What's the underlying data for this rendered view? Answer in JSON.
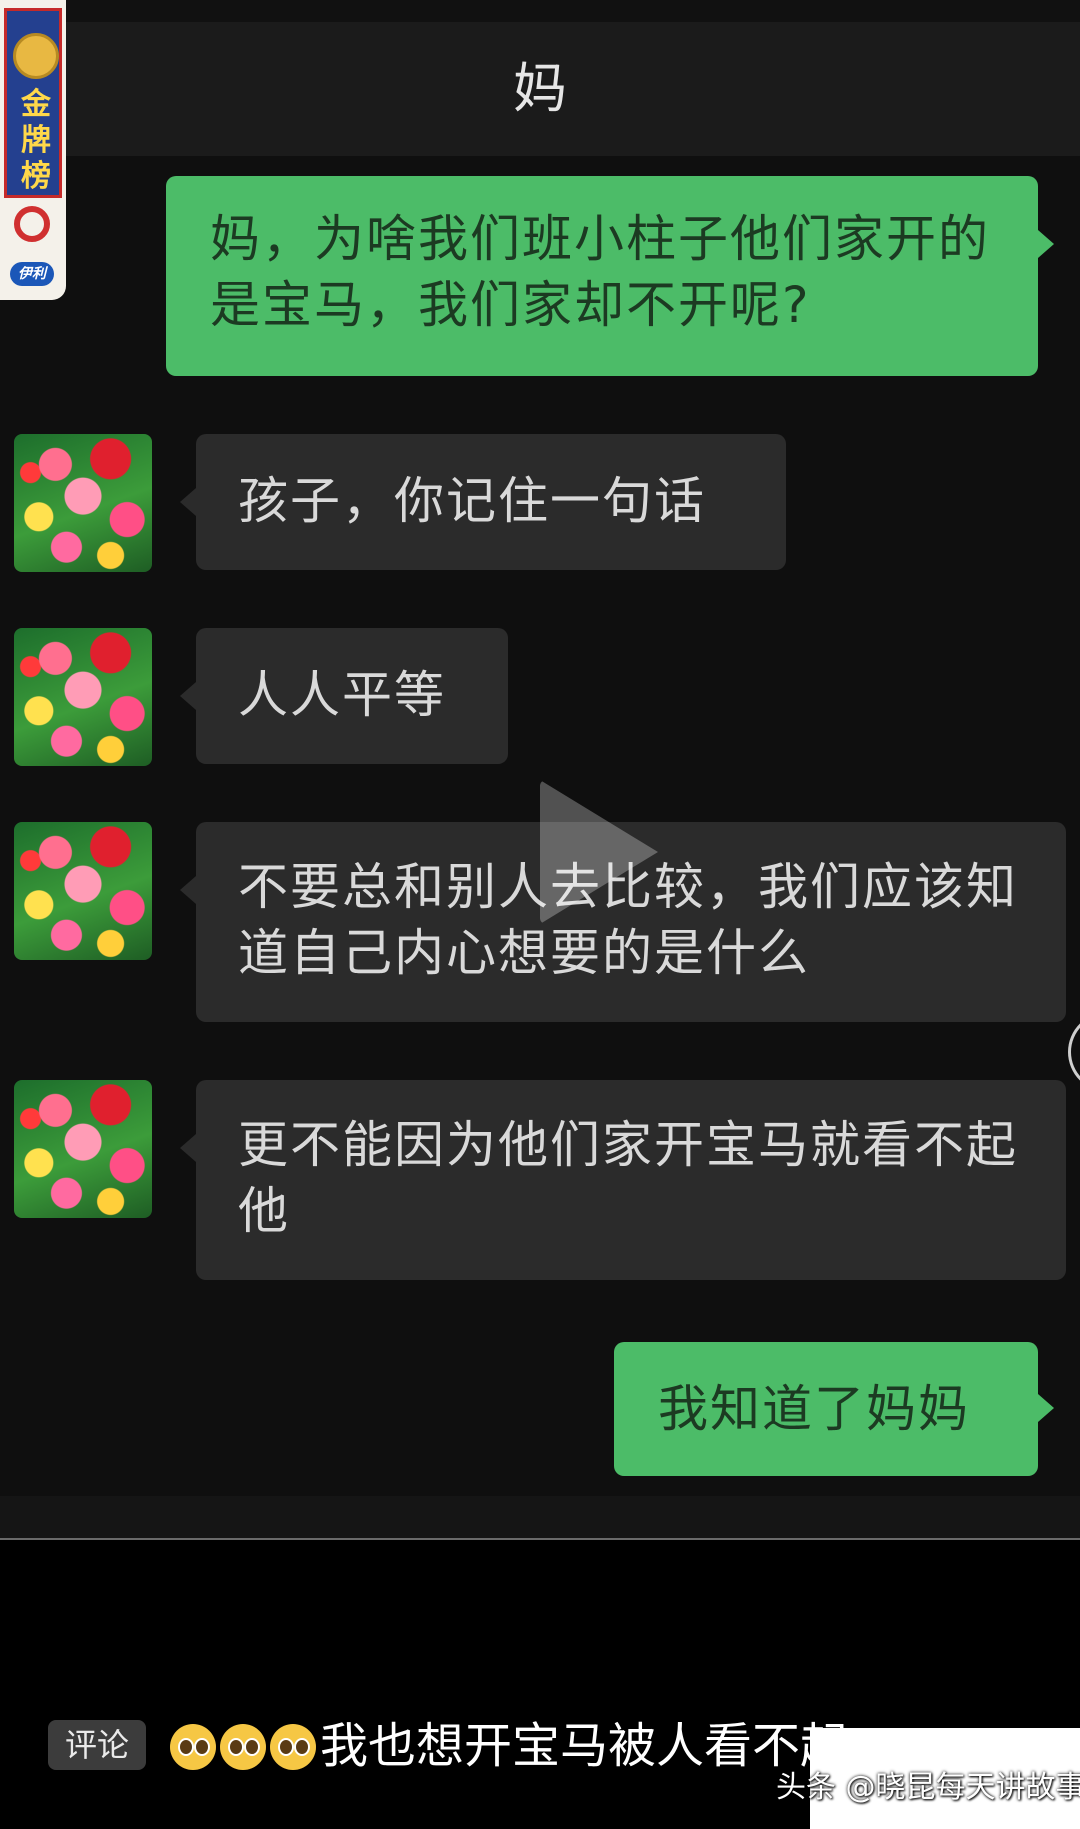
{
  "badge": {
    "medal_label": "金牌榜",
    "sponsor_logo": "伊利"
  },
  "chat": {
    "title": "妈",
    "messages": [
      {
        "side": "out",
        "text": "妈，为啥我们班小柱子他们家开的是宝马，我们家却不开呢?"
      },
      {
        "side": "in",
        "text": "孩子，你记住一句话"
      },
      {
        "side": "in",
        "text": "人人平等"
      },
      {
        "side": "in",
        "text": "不要总和别人去比较，我们应该知道自己内心想要的是什么"
      },
      {
        "side": "in",
        "text": "更不能因为他们家开宝马就看不起他"
      },
      {
        "side": "out",
        "text": "我知道了妈妈"
      }
    ]
  },
  "comment_bar": {
    "chip_label": "评论",
    "emoji_icon": "pleading-face-emoji",
    "emoji_count": 3,
    "comment_text": "我也想开宝马被人看不起"
  },
  "watermark": {
    "text": "头条 @晓昆每天讲故事"
  },
  "colors": {
    "outgoing_bubble": "#4cbc68",
    "incoming_bubble": "#2b2b2b",
    "background": "#000000"
  }
}
